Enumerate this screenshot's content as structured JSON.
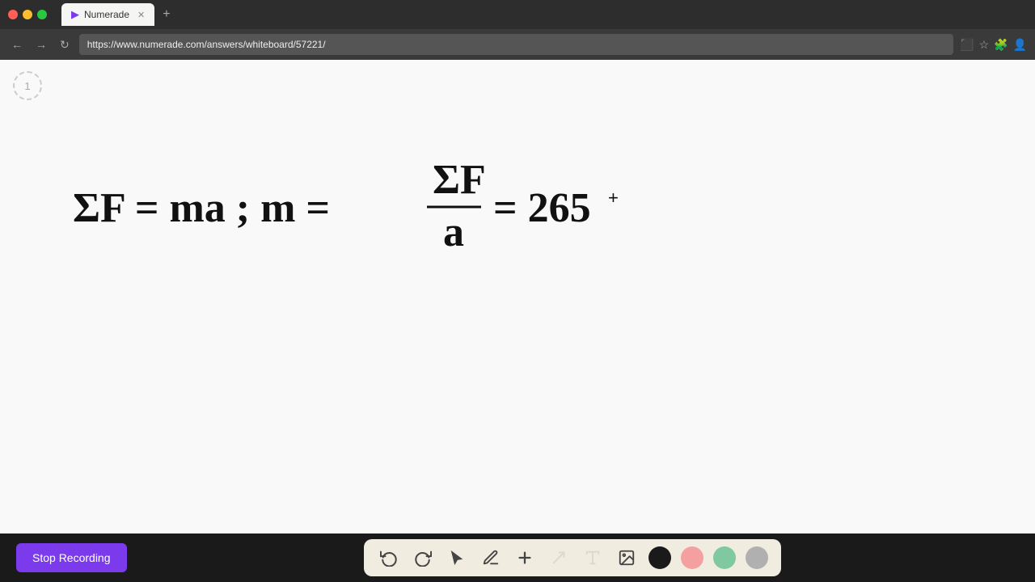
{
  "browser": {
    "url": "https://www.numerade.com/answers/whiteboard/57221/",
    "tab_title": "Numerade",
    "tab_favicon": "▶"
  },
  "page": {
    "number": "1"
  },
  "math": {
    "expression": "ΣF = ma ; m = ΣF/a = 265"
  },
  "toolbar": {
    "stop_recording_label": "Stop Recording",
    "tools": [
      {
        "name": "undo",
        "icon": "↺"
      },
      {
        "name": "redo",
        "icon": "↻"
      },
      {
        "name": "select",
        "icon": "▲"
      },
      {
        "name": "pen",
        "icon": "✏"
      },
      {
        "name": "add",
        "icon": "+"
      },
      {
        "name": "line",
        "icon": "/"
      },
      {
        "name": "text",
        "icon": "T"
      },
      {
        "name": "image",
        "icon": "🖼"
      }
    ],
    "colors": [
      {
        "name": "black",
        "hex": "#1a1a1a"
      },
      {
        "name": "pink",
        "hex": "#f4a0a0"
      },
      {
        "name": "green",
        "hex": "#80c8a0"
      },
      {
        "name": "gray",
        "hex": "#b0b0b0"
      }
    ]
  }
}
